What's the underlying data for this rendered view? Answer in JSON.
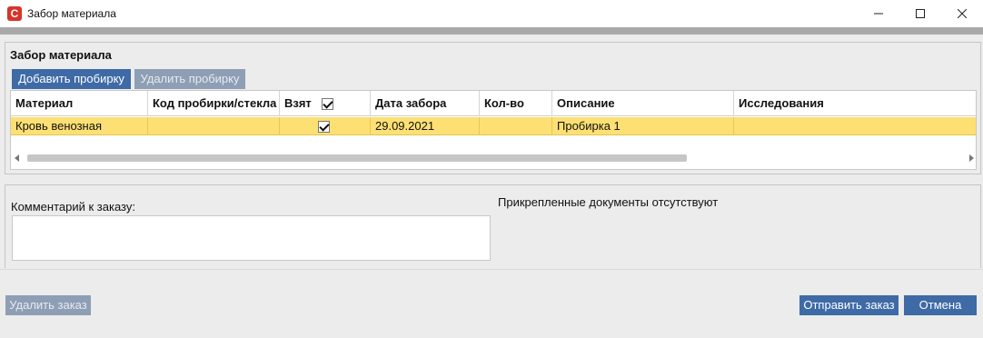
{
  "window": {
    "title": "Забор материала",
    "app_icon_glyph": "C",
    "icons": {
      "minimize": "minimize-icon",
      "maximize": "maximize-icon",
      "close": "close-icon"
    }
  },
  "panel": {
    "title": "Забор материала",
    "add_tube_label": "Добавить пробирку",
    "delete_tube_label": "Удалить пробирку"
  },
  "grid": {
    "columns": [
      "Материал",
      "Код пробирки/стекла",
      "Взят",
      "Дата забора",
      "Кол-во",
      "Описание",
      "Исследования"
    ],
    "rows": [
      {
        "material": "Кровь венозная",
        "tube_code": "",
        "taken": true,
        "date": "29.09.2021",
        "qty": "",
        "description": "Пробирка 1",
        "research": ""
      }
    ],
    "selected_row_color": "#fde073"
  },
  "comment": {
    "label": "Комментарий к заказу:",
    "value": ""
  },
  "documents": {
    "status": "Прикрепленные документы отсутствуют"
  },
  "footer": {
    "delete_order_label": "Удалить заказ",
    "send_order_label": "Отправить заказ",
    "cancel_label": "Отмена"
  },
  "colors": {
    "accent": "#3e6aa6",
    "disabled": "#8e9eb5",
    "brand": "#d9332a"
  }
}
